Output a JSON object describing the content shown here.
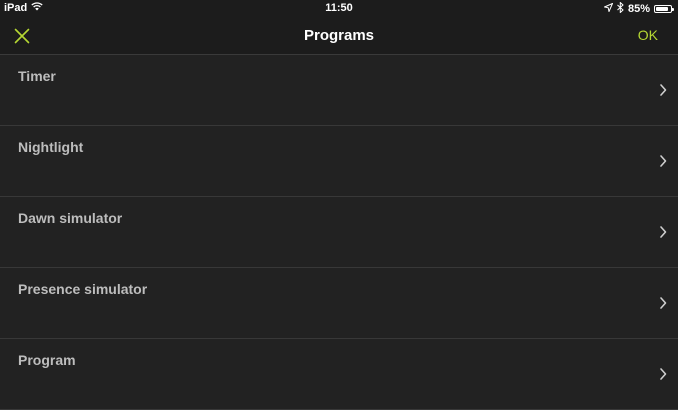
{
  "status_bar": {
    "device": "iPad",
    "time": "11:50",
    "battery": "85%",
    "battery_level": 0.85,
    "icons": [
      "wifi-icon",
      "location-arrow-icon",
      "bluetooth-icon",
      "battery-icon"
    ]
  },
  "nav": {
    "title": "Programs",
    "ok_label": "OK",
    "close_icon": "close-icon"
  },
  "colors": {
    "accent": "#b5d733",
    "background": "#222222",
    "bar": "#1c1c1c",
    "row_text": "#bdbdbd",
    "divider": "#383838"
  },
  "programs": [
    {
      "label": "Timer"
    },
    {
      "label": "Nightlight"
    },
    {
      "label": "Dawn simulator"
    },
    {
      "label": "Presence simulator"
    },
    {
      "label": "Program"
    }
  ]
}
